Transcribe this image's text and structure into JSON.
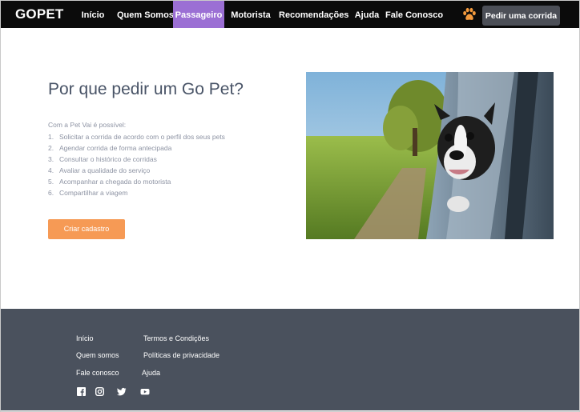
{
  "navbar": {
    "brand": "GOPET",
    "items": [
      {
        "label": "Início"
      },
      {
        "label": "Quem Somos"
      },
      {
        "label": "Passageiro"
      },
      {
        "label": "Motorista"
      },
      {
        "label": "Recomendações"
      },
      {
        "label": "Ajuda"
      },
      {
        "label": "Fale Conosco"
      }
    ],
    "active_item": "Passageiro",
    "cta_label": "Pedir uma corrida",
    "colors": {
      "background": "#0b0b0b",
      "active": "#9b6fd4",
      "paw": "#f39a3d",
      "cta": "#4c4f57"
    }
  },
  "main": {
    "title": "Por que pedir um Go Pet?",
    "intro": "Com a Pet Vai é possível:",
    "features": [
      {
        "num": "1.",
        "text": "Solicitar a corrida de acordo com o perfil dos seus pets"
      },
      {
        "num": "2.",
        "text": "Agendar corrida de forma antecipada"
      },
      {
        "num": "3.",
        "text": "Consultar o histórico de corridas"
      },
      {
        "num": "4.",
        "text": "Avaliar a qualidade do serviço"
      },
      {
        "num": "5.",
        "text": "Acompanhar a chegada do motorista"
      },
      {
        "num": "6.",
        "text": "Compartilhar a viagem"
      }
    ],
    "signup_label": "Criar cadastro",
    "colors": {
      "title": "#495467",
      "body": "#8d93a3",
      "button": "#f69a55"
    }
  },
  "footer": {
    "links": {
      "home": "Início",
      "about": "Quem somos",
      "contact": "Fale conosco",
      "terms": "Termos e Condições",
      "privacy": "Políticas de privacidade",
      "help": "Ajuda"
    },
    "social": [
      "facebook-icon",
      "instagram-icon",
      "twitter-icon",
      "youtube-icon"
    ],
    "colors": {
      "background": "#4a515d"
    }
  }
}
